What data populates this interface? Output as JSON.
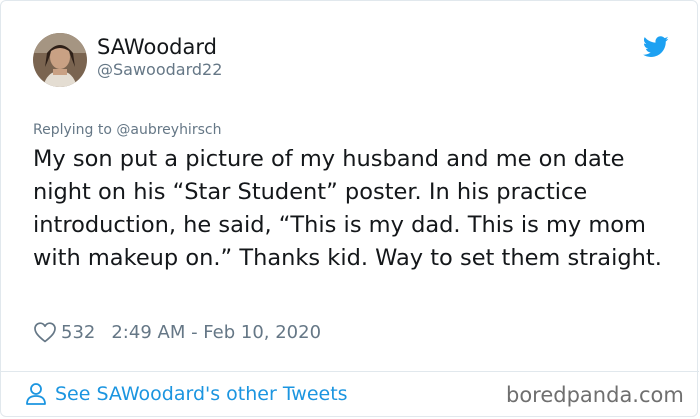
{
  "author": {
    "display_name": "SAWoodard",
    "handle": "@Sawoodard22",
    "avatar_icon": "profile-photo"
  },
  "brand": {
    "icon": "twitter-bird-icon",
    "color": "#1da1f2"
  },
  "tweet": {
    "replying_to": "Replying to @aubreyhirsch",
    "text": "My son put a picture of my husband and me on date night on his “Star Student” poster. In his practice introduction, he said, “This is my dad. This is my mom with makeup on.” Thanks kid. Way to set them straight.",
    "like_count": "532",
    "timestamp": "2:49 AM - Feb 10, 2020"
  },
  "footer": {
    "link_label": "See SAWoodard's other Tweets",
    "link_color": "#1b95e0"
  },
  "watermark": "boredpanda.com"
}
